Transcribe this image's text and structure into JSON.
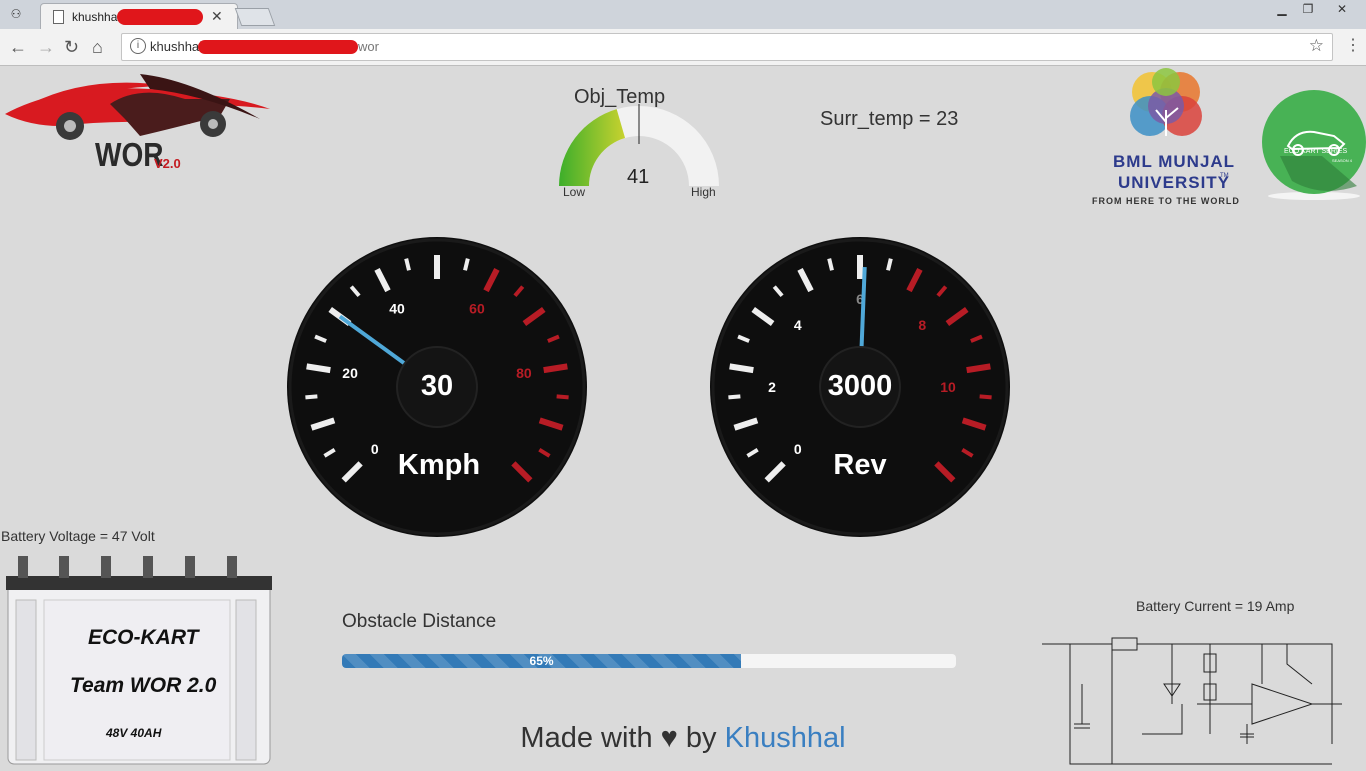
{
  "browser": {
    "tab_title": "khushhal",
    "url_visible_start": "khushhal",
    "url_visible_end": "wor"
  },
  "page": {
    "logo_text": "WOR",
    "logo_version": "V2.0",
    "obj_temp": {
      "title": "Obj_Temp",
      "value": "41",
      "low_label": "Low",
      "high_label": "High",
      "fraction": 0.41
    },
    "surr_temp": "Surr_temp = 23",
    "university": {
      "line1": "BML MUNJAL",
      "line2": "UNIVERSITY",
      "tm": "TM",
      "tagline": "FROM HERE TO THE WORLD"
    },
    "ecokart_badge": {
      "line1": "ECO KART SERIES",
      "line2": "SEASON 4"
    },
    "speed_gauge": {
      "value": "30",
      "unit": "Kmph",
      "ticks": [
        "0",
        "20",
        "40",
        "60",
        "80"
      ],
      "needle_value": 30
    },
    "rev_gauge": {
      "value": "3000",
      "unit": "Rev",
      "ticks": [
        "0",
        "2",
        "4",
        "6",
        "8",
        "10"
      ],
      "needle_value": 6.1
    },
    "battery_voltage": "Battery Voltage = 47 Volt",
    "battery": {
      "line1": "ECO-KART",
      "line2": "Team WOR 2.0",
      "line3": "48V 40AH"
    },
    "obstacle": {
      "label": "Obstacle Distance",
      "percent_label": "65%",
      "percent": 65
    },
    "battery_current": "Battery Current = 19 Amp",
    "footer": {
      "prefix": "Made with ♥ by ",
      "author": "Khushhal"
    },
    "colors": {
      "gauge_green": "#3dae2b",
      "gauge_yellow": "#c8d22f",
      "needle_blue": "#4fa8d8",
      "red_tick": "#b71c25",
      "progress": "#337ab7"
    }
  }
}
